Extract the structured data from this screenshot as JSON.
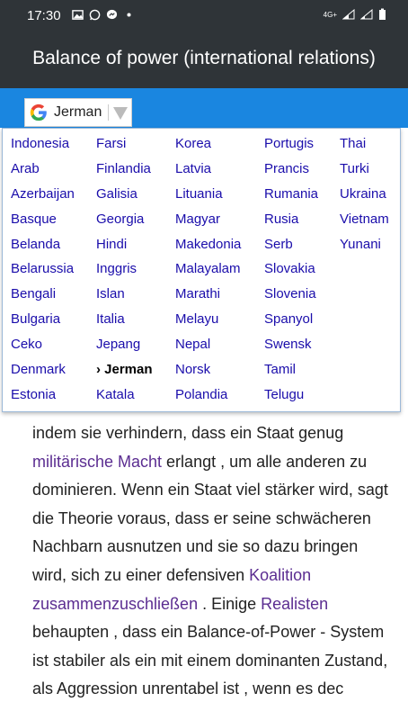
{
  "status_bar": {
    "time": "17:30",
    "network": "4G+"
  },
  "app_bar": {
    "title": "Balance of power (international relations)"
  },
  "translate": {
    "selected_language": "Jerman"
  },
  "language_menu": {
    "columns": [
      [
        "Indonesia",
        "Arab",
        "Azerbaijan",
        "Basque",
        "Belanda",
        "Belarussia",
        "Bengali",
        "Bulgaria",
        "Ceko",
        "Denmark",
        "Estonia"
      ],
      [
        "Farsi",
        "Finlandia",
        "Galisia",
        "Georgia",
        "Hindi",
        "Inggris",
        "Islan",
        "Italia",
        "Jepang",
        "› Jerman",
        "Katala"
      ],
      [
        "Korea",
        "Latvia",
        "Lituania",
        "Magyar",
        "Makedonia",
        "Malayalam",
        "Marathi",
        "Melayu",
        "Nepal",
        "Norsk",
        "Polandia"
      ],
      [
        "Portugis",
        "Prancis",
        "Rumania",
        "Rusia",
        "Serb",
        "Slovakia",
        "Slovenia",
        "Spanyol",
        "Swensk",
        "Tamil",
        "Telugu"
      ],
      [
        "Thai",
        "Turki",
        "Ukraina",
        "Vietnam",
        "Yunani"
      ]
    ]
  },
  "article": {
    "segments": [
      {
        "text": " indem sie verhindern, dass ein Staat genug ",
        "link": false
      },
      {
        "text": "militärische Macht",
        "link": true
      },
      {
        "text": " erlangt  , um alle anderen zu dominieren.  Wenn ein Staat viel stärker wird, sagt die Theorie voraus, dass er seine schwächeren Nachbarn ausnutzen und sie so dazu bringen wird, sich zu einer defensiven ",
        "link": false
      },
      {
        "text": "Koalition zusammenzuschließen",
        "link": true
      },
      {
        "text": " . Einige ",
        "link": false
      },
      {
        "text": "Realisten",
        "link": true
      },
      {
        "text": "  behaupten , dass ein Balance-of-Power - System ist stabiler als ein mit einem dominanten Zustand, als Aggression unrentabel ist , wenn es  dec",
        "link": false
      }
    ]
  },
  "colors": {
    "status_bg": "#2f3438",
    "blue_bar": "#1a86e0",
    "menu_link": "#1a0dab",
    "article_link": "#5b2d91"
  }
}
